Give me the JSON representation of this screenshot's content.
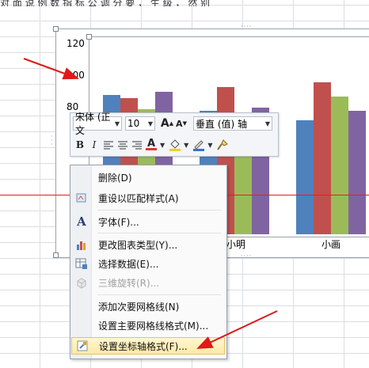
{
  "top_text": "对 面 说   例 数 指 标 公  调 分 要 ，  生 级 ， 然 别",
  "chart": {
    "y_ticks": [
      "120",
      "100",
      "80"
    ],
    "categories_visible": [
      "小明",
      "小画"
    ]
  },
  "chart_data": {
    "type": "bar",
    "categories": [
      "",
      "小明",
      "小画"
    ],
    "ylim": [
      0,
      120
    ],
    "y_ticks": [
      80,
      100,
      120
    ],
    "series": [
      {
        "color": "#4f81bd",
        "values": [
          88,
          78,
          72
        ]
      },
      {
        "color": "#c0504d",
        "values": [
          86,
          93,
          96
        ]
      },
      {
        "color": "#9bbb59",
        "values": [
          79,
          70,
          87
        ]
      },
      {
        "color": "#8064a2",
        "values": [
          90,
          80,
          78
        ]
      }
    ]
  },
  "mini_toolbar": {
    "font_name": "宋体 (正文",
    "font_size": "10",
    "grow_font": "A",
    "shrink_font": "A",
    "target": "垂直 (值) 轴",
    "bold": "B",
    "italic": "I",
    "font_color_glyph": "A",
    "font_color": "#d63b2f",
    "fill_color": "#f0d020",
    "outline_color": "#3a6fc4"
  },
  "context_menu": {
    "items": [
      {
        "label": "删除(D)",
        "icon": "none"
      },
      {
        "label": "重设以匹配样式(A)",
        "icon": "reset-style-icon"
      },
      {
        "label": "字体(F)...",
        "icon": "font-icon"
      },
      {
        "label": "更改图表类型(Y)...",
        "icon": "chart-type-icon"
      },
      {
        "label": "选择数据(E)...",
        "icon": "select-data-icon"
      },
      {
        "label": "三维旋转(R)...",
        "icon": "3d-rotation-icon"
      },
      {
        "label": "添加次要网格线(N)",
        "icon": "none"
      },
      {
        "label": "设置主要网格线格式(M)...",
        "icon": "none"
      },
      {
        "label": "设置坐标轴格式(F)...",
        "icon": "format-axis-icon"
      }
    ]
  }
}
